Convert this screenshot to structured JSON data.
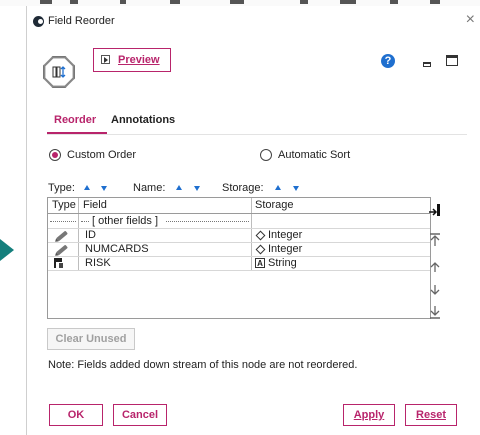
{
  "window": {
    "title": "Field Reorder",
    "close_glyph": "×"
  },
  "toolbar": {
    "preview_label": "Preview",
    "help_glyph": "?"
  },
  "tabs": [
    {
      "label": "Reorder",
      "active": true
    },
    {
      "label": "Annotations",
      "active": false
    }
  ],
  "order_mode": {
    "custom_label": "Custom Order",
    "automatic_label": "Automatic Sort",
    "selected": "custom"
  },
  "sort_by": [
    {
      "label": "Type:"
    },
    {
      "label": "Name:"
    },
    {
      "label": "Storage:"
    }
  ],
  "table": {
    "headers": [
      "Type",
      "Field",
      "Storage"
    ],
    "other_fields_label": "[ other fields ]",
    "rows": [
      {
        "type_icon": "pencil-icon",
        "field": "ID",
        "storage_icon": "diamond-icon",
        "storage": "Integer"
      },
      {
        "type_icon": "pencil-icon",
        "field": "NUMCARDS",
        "storage_icon": "diamond-icon",
        "storage": "Integer"
      },
      {
        "type_icon": "flag-icon",
        "field": "RISK",
        "storage_icon": "string-a-icon",
        "storage_glyph": "A",
        "storage": "String"
      }
    ]
  },
  "buttons": {
    "clear_unused": "Clear Unused",
    "ok": "OK",
    "cancel": "Cancel",
    "apply": "Apply",
    "reset": "Reset"
  },
  "note": "Note: Fields added down stream of this node are not reordered.",
  "colors": {
    "accent": "#b8246b",
    "arrow_blue": "#1f6fcf",
    "canvas_teal": "#147f7c"
  }
}
